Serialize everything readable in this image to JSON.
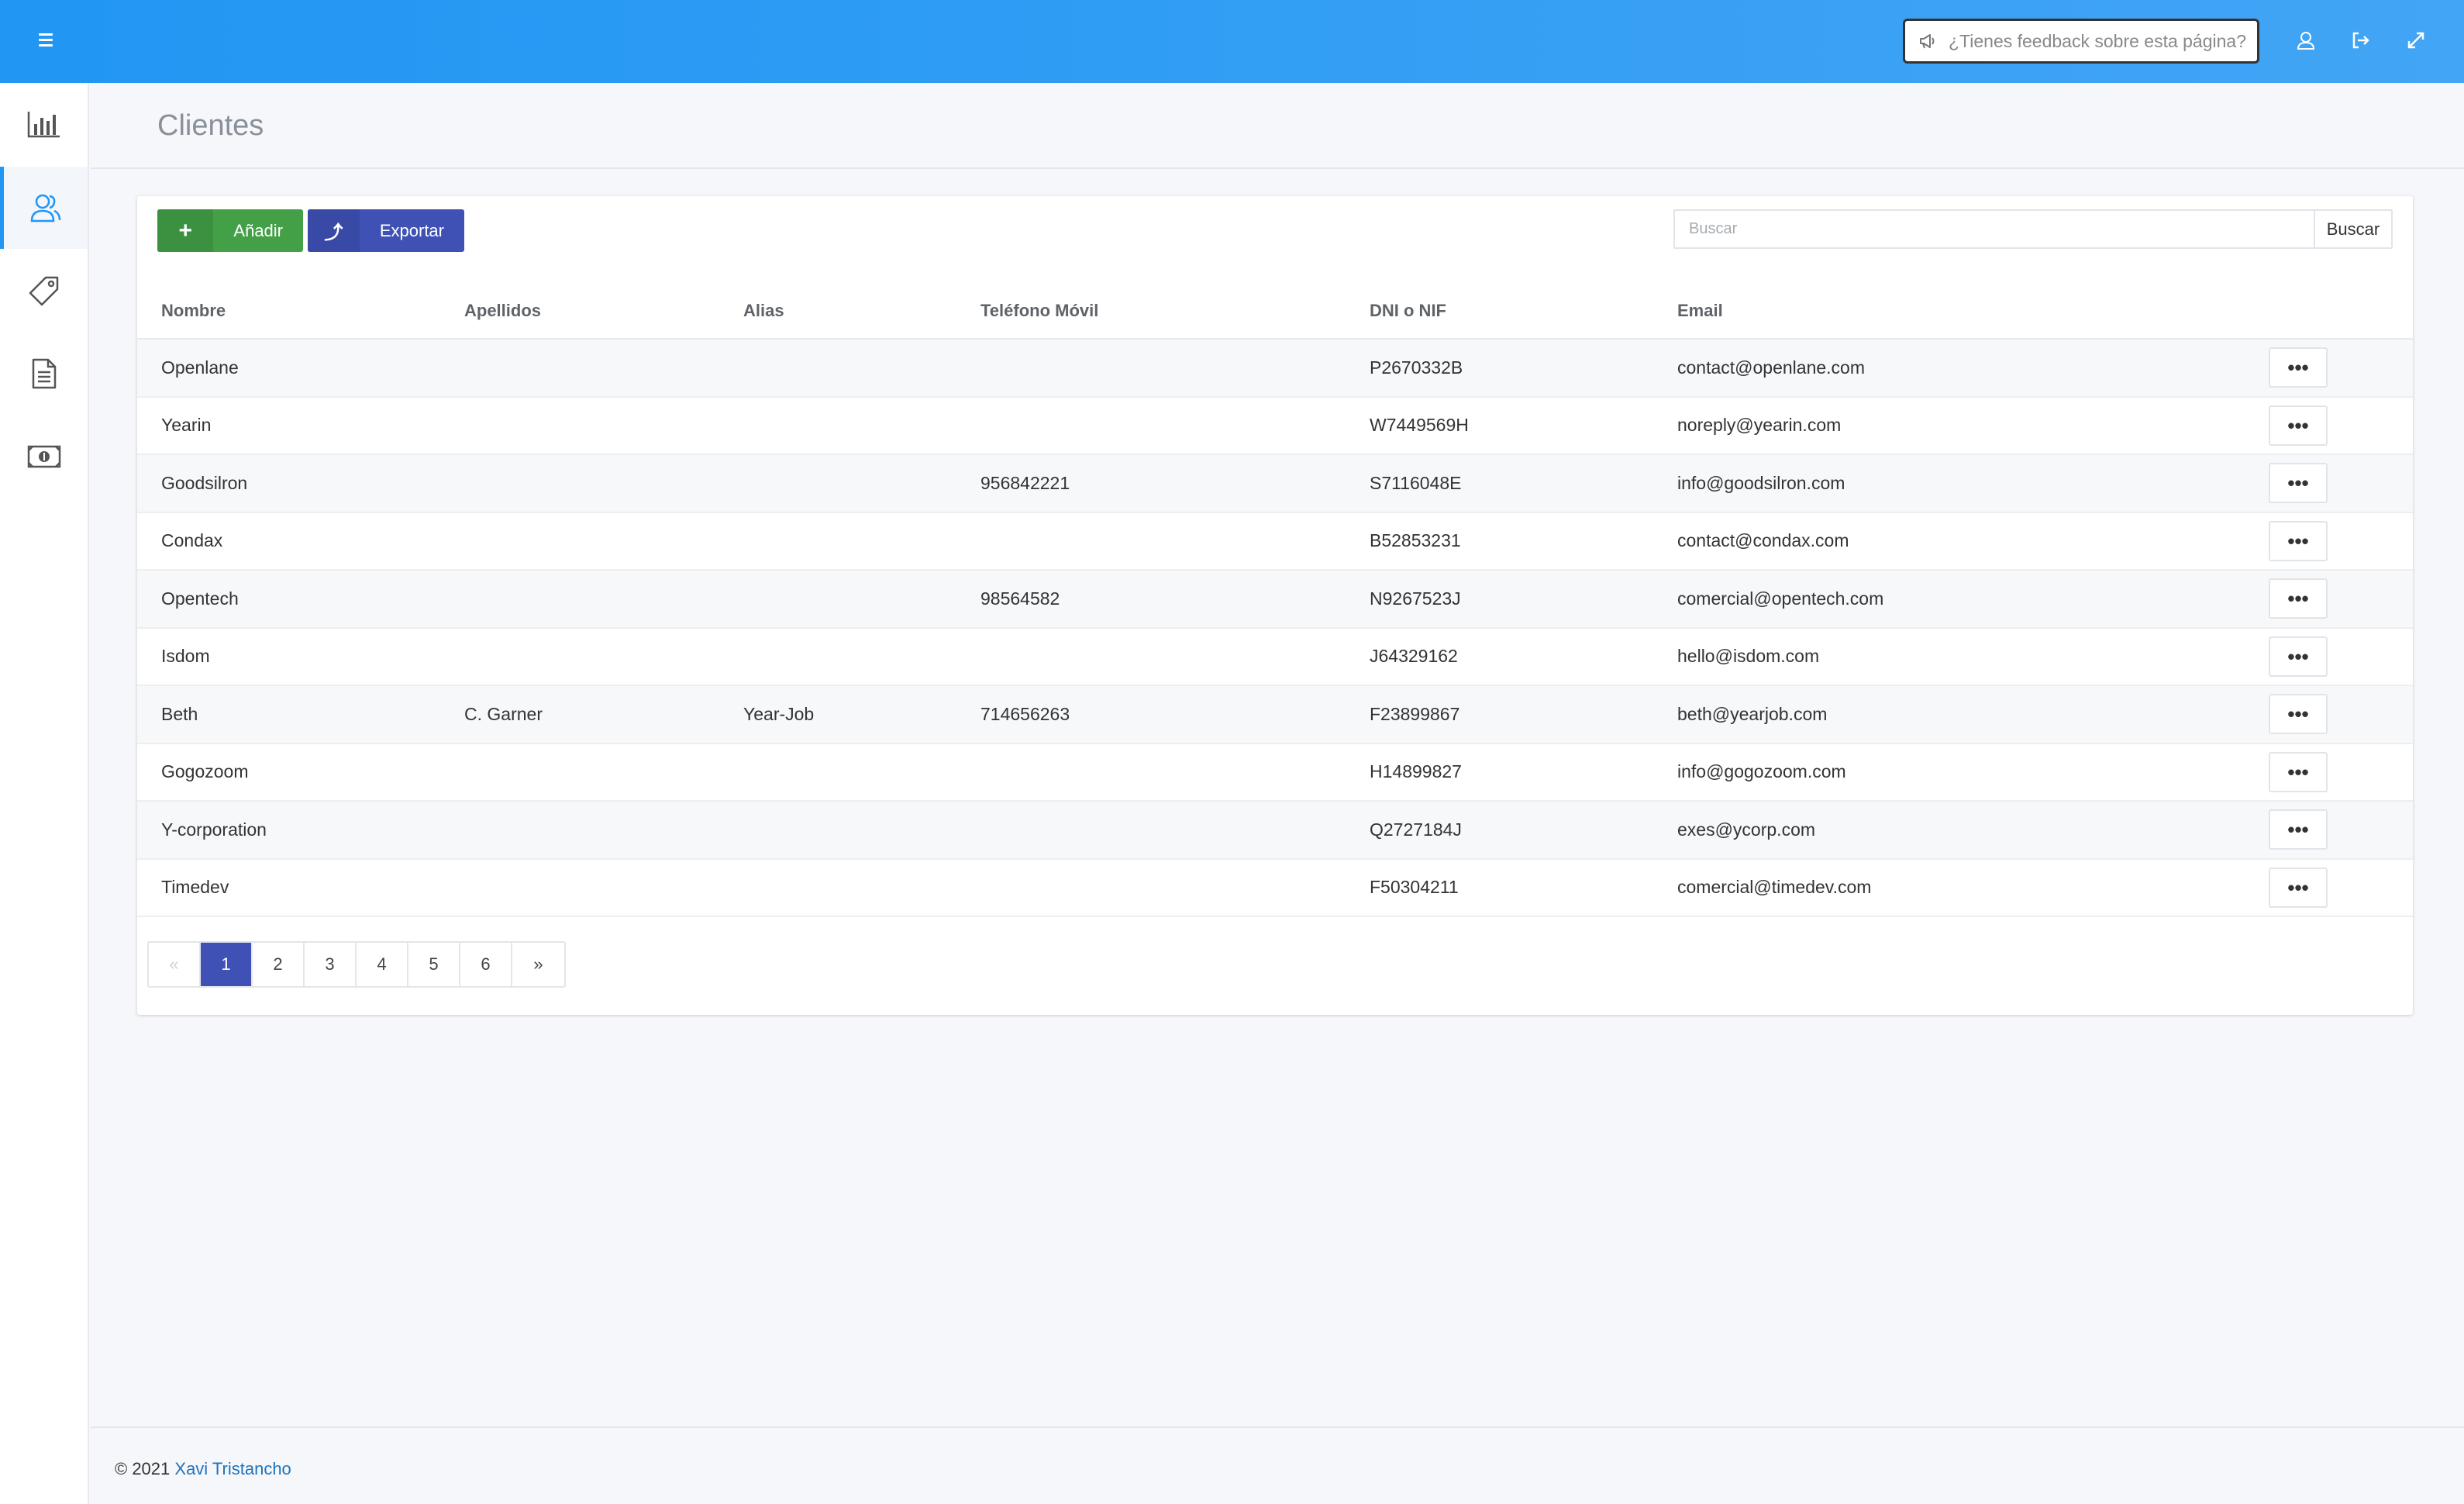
{
  "header": {
    "feedback_placeholder": "¿Tienes feedback sobre esta página?"
  },
  "sidebar": {
    "items": [
      {
        "icon": "bar-chart-icon"
      },
      {
        "icon": "users-icon",
        "active": true
      },
      {
        "icon": "tag-icon"
      },
      {
        "icon": "document-icon"
      },
      {
        "icon": "money-icon"
      }
    ]
  },
  "page": {
    "title": "Clientes"
  },
  "toolbar": {
    "add_label": "Añadir",
    "add_icon": "+",
    "export_label": "Exportar",
    "export_icon": "⤴",
    "search_placeholder": "Buscar",
    "search_button": "Buscar"
  },
  "table": {
    "columns": [
      "Nombre",
      "Apellidos",
      "Alias",
      "Teléfono Móvil",
      "DNI o NIF",
      "Email"
    ],
    "actions_label": "•••",
    "rows": [
      {
        "nombre": "Openlane",
        "apellidos": "",
        "alias": "",
        "telefono": "",
        "dni": "P2670332B",
        "email": "contact@openlane.com"
      },
      {
        "nombre": "Yearin",
        "apellidos": "",
        "alias": "",
        "telefono": "",
        "dni": "W7449569H",
        "email": "noreply@yearin.com"
      },
      {
        "nombre": "Goodsilron",
        "apellidos": "",
        "alias": "",
        "telefono": "956842221",
        "dni": "S7116048E",
        "email": "info@goodsilron.com"
      },
      {
        "nombre": "Condax",
        "apellidos": "",
        "alias": "",
        "telefono": "",
        "dni": "B52853231",
        "email": "contact@condax.com"
      },
      {
        "nombre": "Opentech",
        "apellidos": "",
        "alias": "",
        "telefono": "98564582",
        "dni": "N9267523J",
        "email": "comercial@opentech.com"
      },
      {
        "nombre": "Isdom",
        "apellidos": "",
        "alias": "",
        "telefono": "",
        "dni": "J64329162",
        "email": "hello@isdom.com"
      },
      {
        "nombre": "Beth",
        "apellidos": "C. Garner",
        "alias": "Year-Job",
        "telefono": "714656263",
        "dni": "F23899867",
        "email": "beth@yearjob.com"
      },
      {
        "nombre": "Gogozoom",
        "apellidos": "",
        "alias": "",
        "telefono": "",
        "dni": "H14899827",
        "email": "info@gogozoom.com"
      },
      {
        "nombre": "Y-corporation",
        "apellidos": "",
        "alias": "",
        "telefono": "",
        "dni": "Q2727184J",
        "email": "exes@ycorp.com"
      },
      {
        "nombre": "Timedev",
        "apellidos": "",
        "alias": "",
        "telefono": "",
        "dni": "F50304211",
        "email": "comercial@timedev.com"
      }
    ]
  },
  "pagination": {
    "prev": "«",
    "next": "»",
    "pages": [
      "1",
      "2",
      "3",
      "4",
      "5",
      "6"
    ],
    "current": "1"
  },
  "footer": {
    "copyright": "© 2021",
    "author": "Xavi Tristancho"
  },
  "colors": {
    "topbar": "#2196f3",
    "add_button": "#43a047",
    "export_button": "#3f51b5",
    "active_page": "#3f51b5"
  }
}
